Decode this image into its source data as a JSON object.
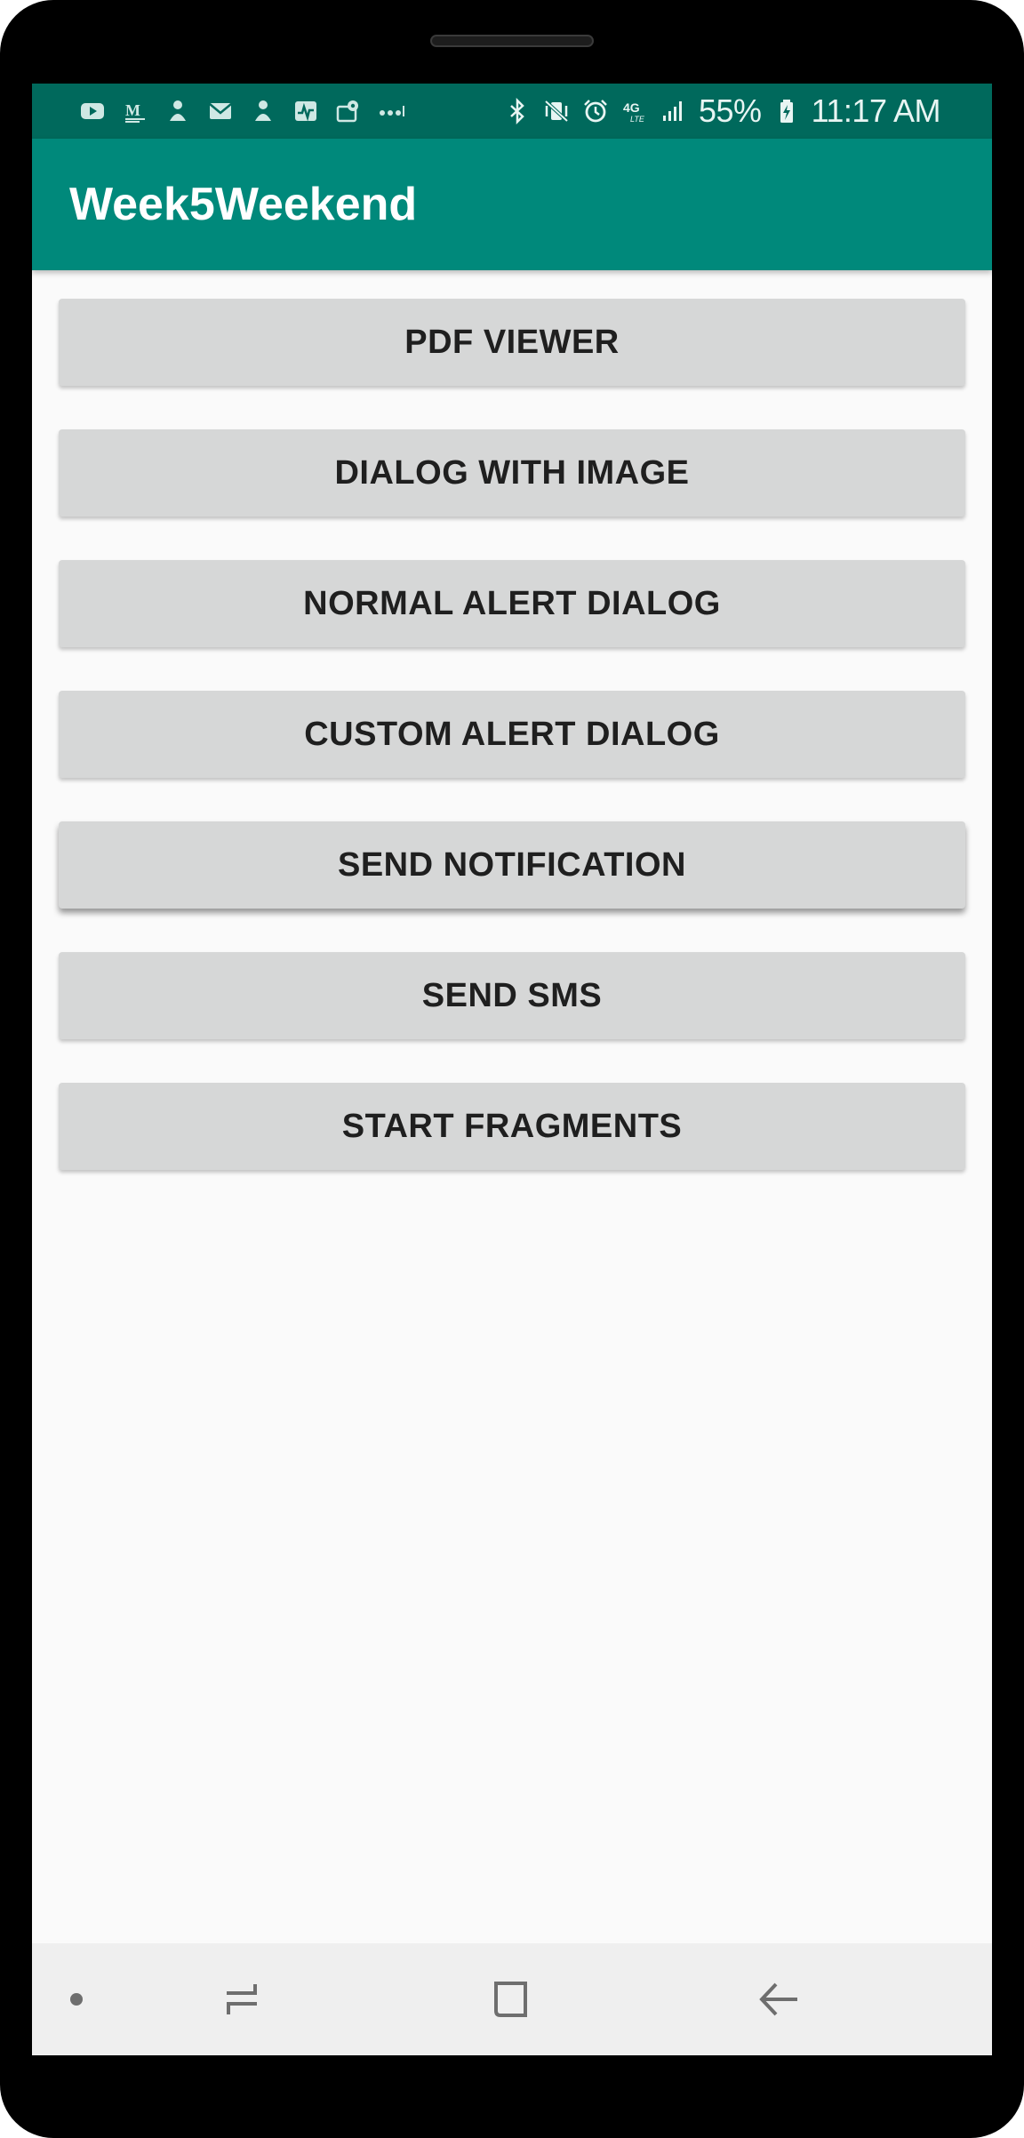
{
  "status_bar": {
    "left_icons": [
      "youtube-icon",
      "gmail-m-icon",
      "cloud-person-icon",
      "mail-icon",
      "cloud-person-icon",
      "activity-icon",
      "map-pin-icon",
      "more-dots-icon"
    ],
    "right_icons": [
      "bluetooth-icon",
      "vibrate-off-icon",
      "alarm-icon",
      "network-4g-lte-icon",
      "signal-icon"
    ],
    "battery_percent": "55%",
    "time": "11:17 AM"
  },
  "app_bar": {
    "title": "Week5Weekend"
  },
  "buttons": [
    {
      "label": "PDF VIEWER"
    },
    {
      "label": "DIALOG WITH IMAGE"
    },
    {
      "label": "NORMAL ALERT DIALOG"
    },
    {
      "label": "CUSTOM ALERT DIALOG"
    },
    {
      "label": "SEND NOTIFICATION"
    },
    {
      "label": "SEND SMS"
    },
    {
      "label": "START FRAGMENTS"
    }
  ],
  "nav_bar": {
    "icons": [
      "dot-icon",
      "recent-apps-icon",
      "home-icon",
      "back-icon"
    ]
  },
  "colors": {
    "status_bar": "#00695c",
    "app_bar": "#00897b",
    "button_bg": "#d6d7d7",
    "screen_bg": "#fafafa",
    "nav_bar": "#efefef"
  }
}
